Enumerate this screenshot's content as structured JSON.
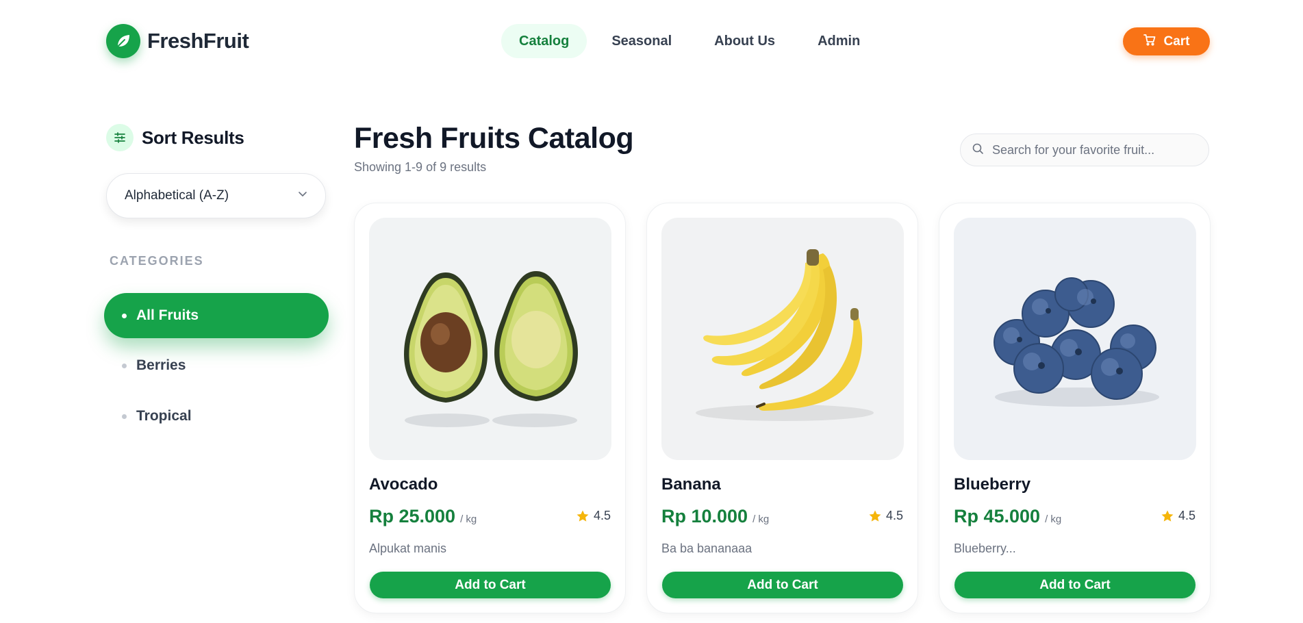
{
  "brand": {
    "name": "FreshFruit",
    "color": "#16a34a",
    "icon": "leaf-icon"
  },
  "nav": {
    "items": [
      {
        "label": "Catalog",
        "active": true
      },
      {
        "label": "Seasonal",
        "active": false
      },
      {
        "label": "About Us",
        "active": false
      },
      {
        "label": "Admin",
        "active": false
      }
    ],
    "cart_label": "Cart",
    "cart_icon": "cart-icon",
    "cart_color": "#f97316"
  },
  "sidebar": {
    "sort_title": "Sort Results",
    "sort_icon": "sliders-icon",
    "sort_value": "Alphabetical (A-Z)",
    "categories_label": "CATEGORIES",
    "categories": [
      {
        "label": "All Fruits",
        "active": true
      },
      {
        "label": "Berries",
        "active": false
      },
      {
        "label": "Tropical",
        "active": false
      }
    ]
  },
  "main": {
    "title": "Fresh Fruits Catalog",
    "result_count": "Showing 1-9 of 9 results",
    "search_placeholder": "Search for your favorite fruit...",
    "products": [
      {
        "name": "Avocado",
        "price": "Rp 25.000",
        "unit": "/ kg",
        "rating": "4.5",
        "description": "Alpukat manis",
        "button": "Add to Cart",
        "image": "avocado-image"
      },
      {
        "name": "Banana",
        "price": "Rp 10.000",
        "unit": "/ kg",
        "rating": "4.5",
        "description": "Ba ba bananaaa",
        "button": "Add to Cart",
        "image": "banana-image"
      },
      {
        "name": "Blueberry",
        "price": "Rp 45.000",
        "unit": "/ kg",
        "rating": "4.5",
        "description": "Blueberry...",
        "button": "Add to Cart",
        "image": "blueberry-image"
      }
    ]
  }
}
